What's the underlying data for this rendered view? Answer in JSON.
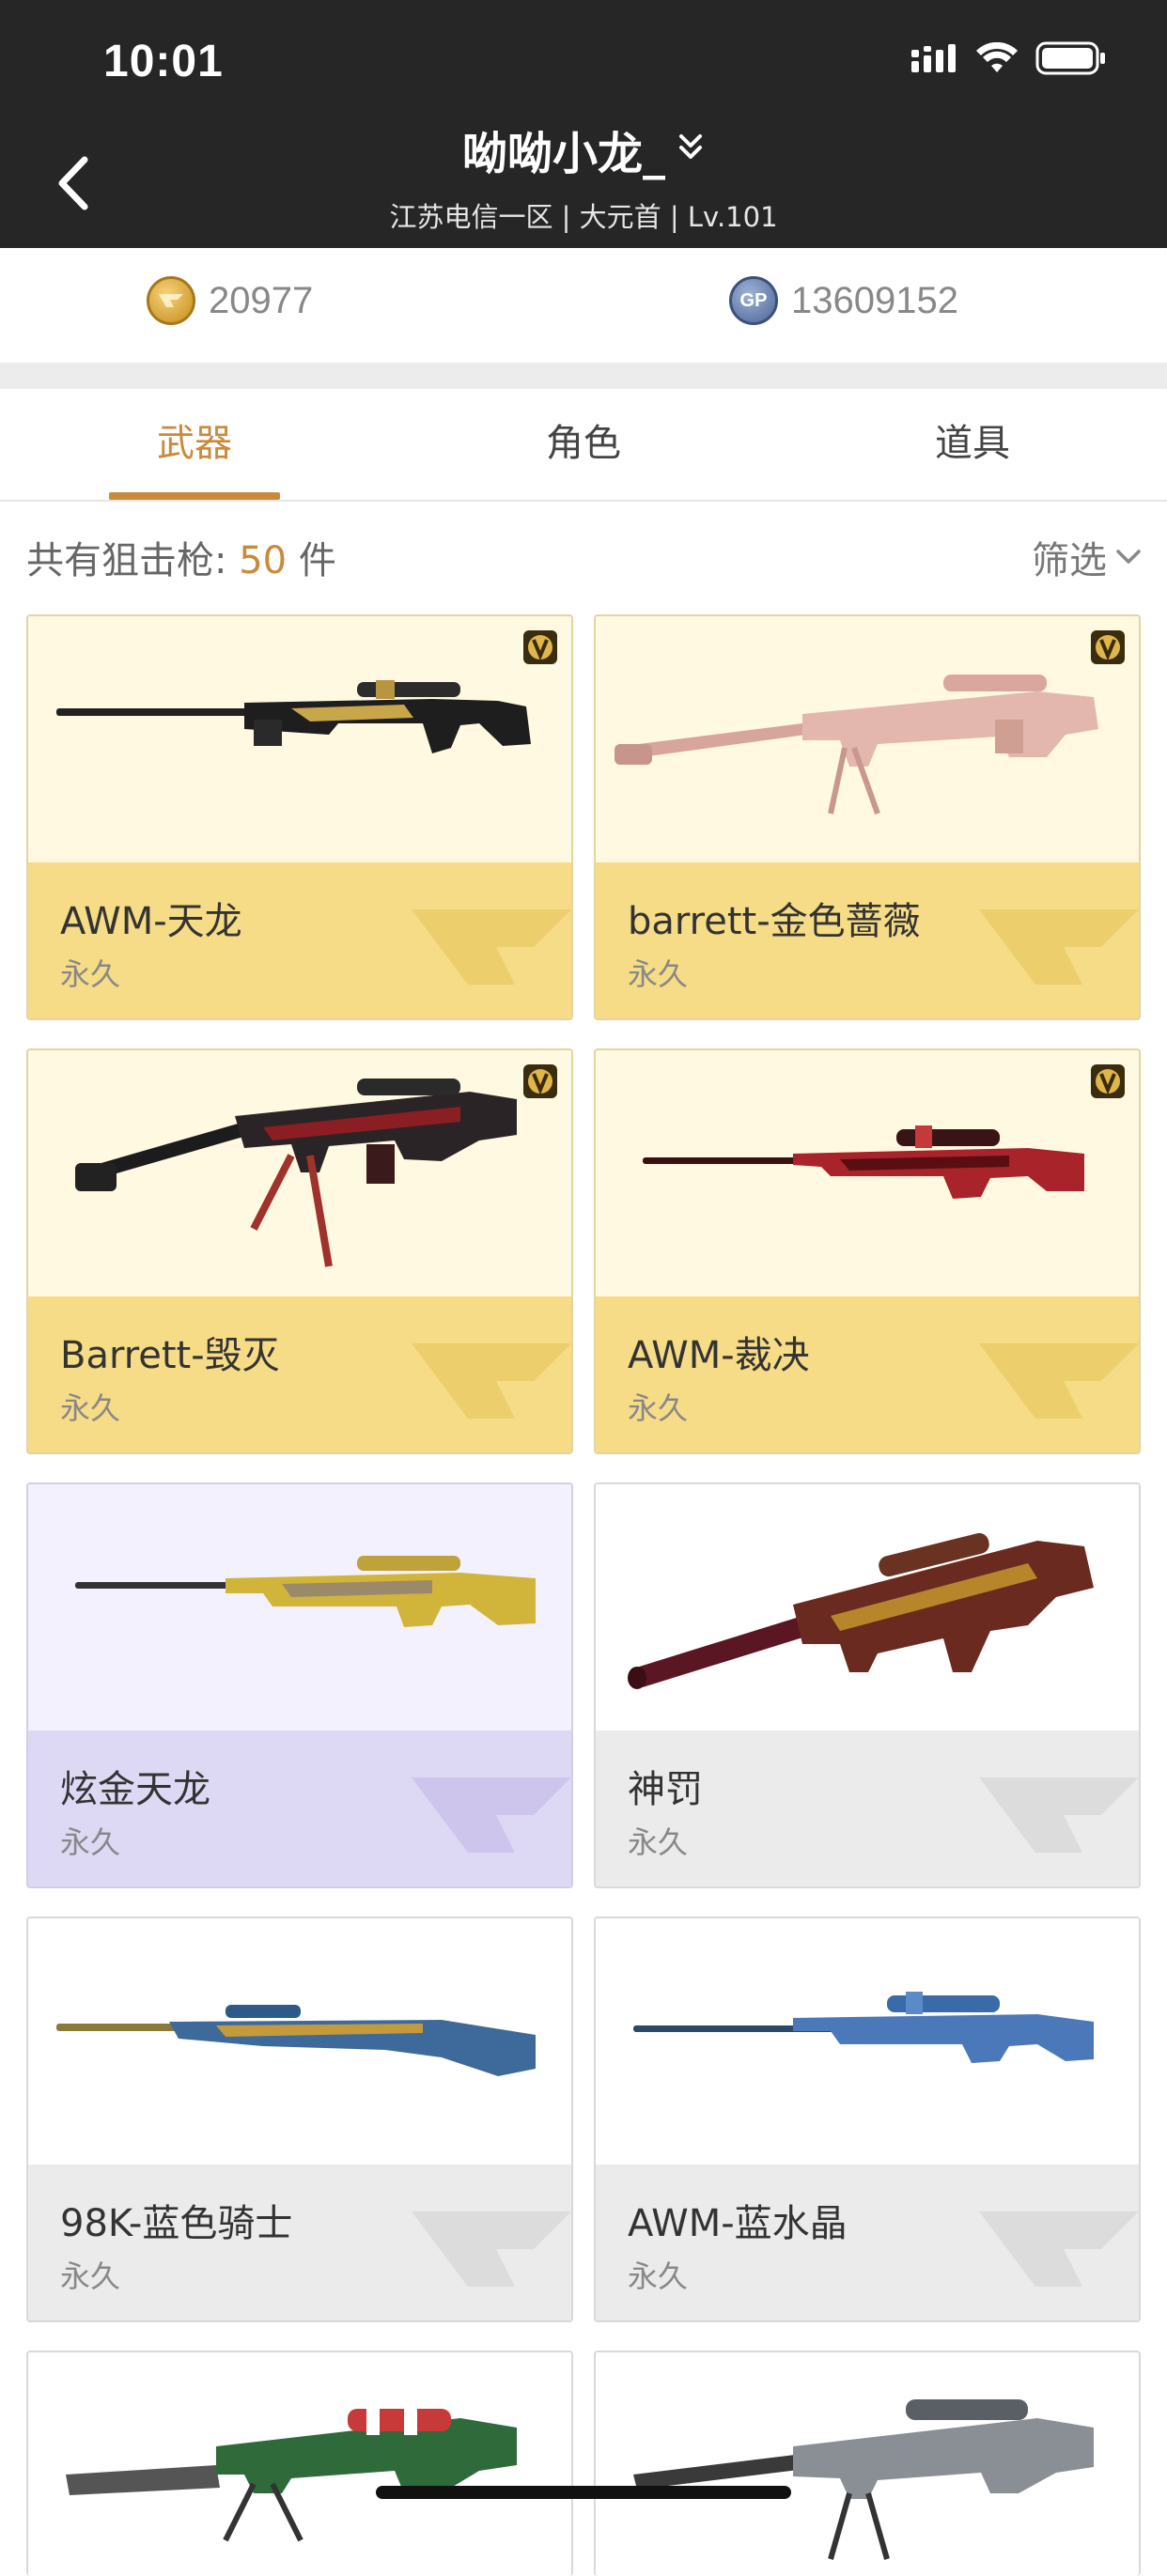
{
  "status_bar": {
    "time": "10:01"
  },
  "header": {
    "title": "呦呦小龙_",
    "subtitle": "江苏电信一区 | 大元首 | Lv.101"
  },
  "currency": {
    "cf_points": "20977",
    "gp_points": "13609152",
    "gp_icon_text": "GP"
  },
  "tabs": [
    {
      "label": "武器",
      "active": true
    },
    {
      "label": "角色",
      "active": false
    },
    {
      "label": "道具",
      "active": false
    }
  ],
  "filter": {
    "count_prefix": "共有狙击枪: ",
    "count": "50",
    "count_suffix": " 件",
    "filter_label": "筛选"
  },
  "items": [
    {
      "name": "AWM-天龙",
      "duration": "永久",
      "theme": "gold",
      "vip": true,
      "icon": "sniper-rifle-icon"
    },
    {
      "name": "barrett-金色蔷薇",
      "duration": "永久",
      "theme": "gold",
      "vip": true,
      "icon": "sniper-rifle-icon"
    },
    {
      "name": "Barrett-毁灭",
      "duration": "永久",
      "theme": "gold",
      "vip": true,
      "icon": "sniper-rifle-icon"
    },
    {
      "name": "AWM-裁决",
      "duration": "永久",
      "theme": "gold",
      "vip": true,
      "icon": "sniper-rifle-icon"
    },
    {
      "name": "炫金天龙",
      "duration": "永久",
      "theme": "purple",
      "vip": false,
      "icon": "sniper-rifle-icon"
    },
    {
      "name": "神罚",
      "duration": "永久",
      "theme": "grey",
      "vip": false,
      "icon": "sniper-rifle-icon"
    },
    {
      "name": "98K-蓝色骑士",
      "duration": "永久",
      "theme": "grey",
      "vip": false,
      "icon": "sniper-rifle-icon"
    },
    {
      "name": "AWM-蓝水晶",
      "duration": "永久",
      "theme": "grey",
      "vip": false,
      "icon": "sniper-rifle-icon"
    }
  ],
  "colors": {
    "accent": "#c98a3c",
    "header_bg": "#262626",
    "gold_card": "#f6dc86",
    "purple_card": "#ddd8f4",
    "grey_card": "#ebebeb"
  }
}
